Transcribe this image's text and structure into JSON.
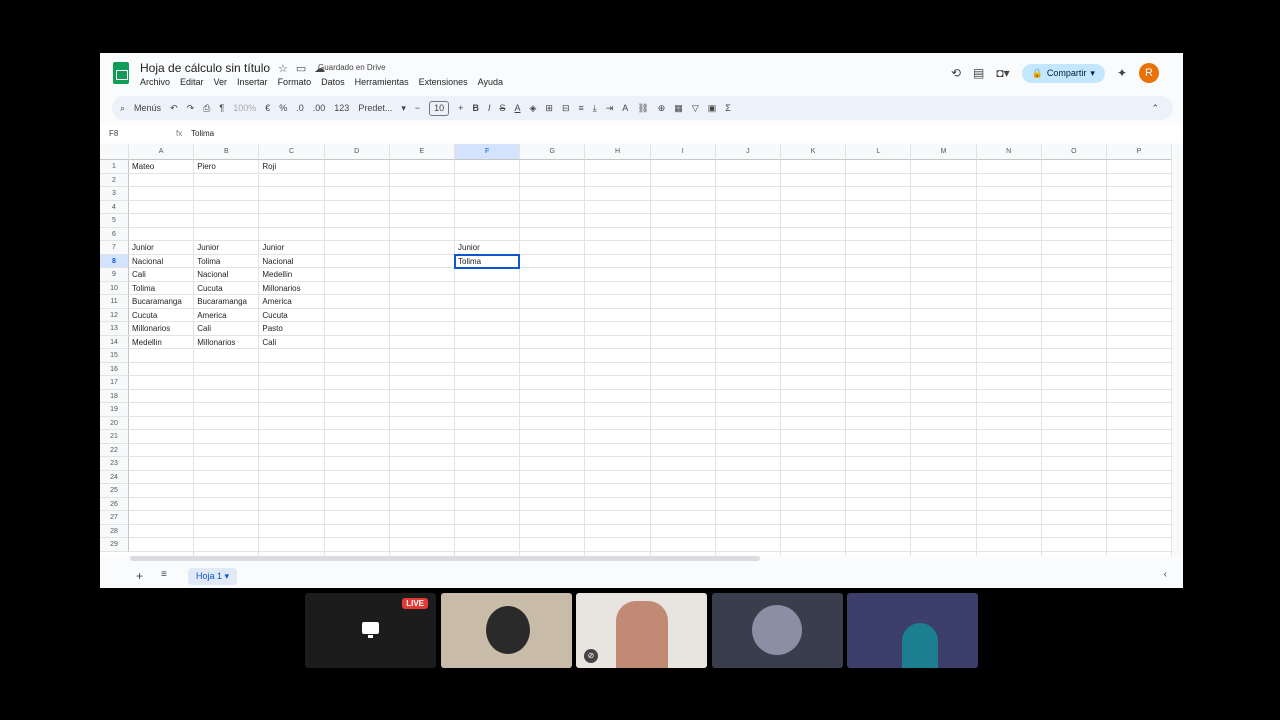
{
  "doc": {
    "title": "Hoja de cálculo sin título",
    "saved_status": "Guardado en Drive"
  },
  "menus": [
    "Archivo",
    "Editar",
    "Ver",
    "Insertar",
    "Formato",
    "Datos",
    "Herramientas",
    "Extensiones",
    "Ayuda"
  ],
  "header": {
    "share_label": "Compartir",
    "avatar_letter": "R"
  },
  "toolbar": {
    "menus_label": "Menús",
    "zoom": "100%",
    "currency": "€",
    "percent": "%",
    "dec_less": ".0",
    "dec_more": ".00",
    "format_123": "123",
    "font": "Predet...",
    "font_size": "10",
    "bold": "B",
    "italic": "I",
    "strike": "S",
    "text_color": "A",
    "sigma": "Σ"
  },
  "formula_bar": {
    "cell_ref": "F8",
    "fx": "fx",
    "value": "Tolima"
  },
  "columns": [
    "A",
    "B",
    "C",
    "D",
    "E",
    "F",
    "G",
    "H",
    "I",
    "J",
    "K",
    "L",
    "M",
    "N",
    "O",
    "P"
  ],
  "selected_column": "F",
  "rows": [
    "1",
    "2",
    "3",
    "4",
    "5",
    "6",
    "7",
    "8",
    "9",
    "10",
    "11",
    "12",
    "13",
    "14",
    "15",
    "16",
    "17",
    "18",
    "19",
    "20",
    "21",
    "22",
    "23",
    "24",
    "25",
    "26",
    "27",
    "28",
    "29"
  ],
  "selected_row": "8",
  "cells": {
    "A1": "Mateo",
    "B1": "Piero",
    "C1": "Roji",
    "A7": "Junior",
    "B7": "Junior",
    "C7": "Junior",
    "A8": "Nacional",
    "B8": "Tolima",
    "C8": "Nacional",
    "A9": "Cali",
    "B9": "Nacional",
    "C9": "Medellin",
    "A10": "Tolima",
    "B10": "Cucuta",
    "C10": "Millonarios",
    "A11": "Bucaramanga",
    "B11": "Bucaramanga",
    "C11": "America",
    "A12": "Cucuta",
    "B12": "America",
    "C12": "Cucuta",
    "A13": "Millonarios",
    "B13": "Cali",
    "C13": "Pasto",
    "A14": "Medellin",
    "B14": "Millonarios",
    "C14": "Cali",
    "F7": "Junior",
    "F8": "Tolima"
  },
  "sheet_tabs": [
    "Hoja 1"
  ],
  "call": {
    "live_badge": "LIVE",
    "tile_colors": [
      "#1c1c1c",
      "#c8bba8",
      "#e8e4e0",
      "#3a3d4c",
      "#3b3f6a"
    ]
  }
}
